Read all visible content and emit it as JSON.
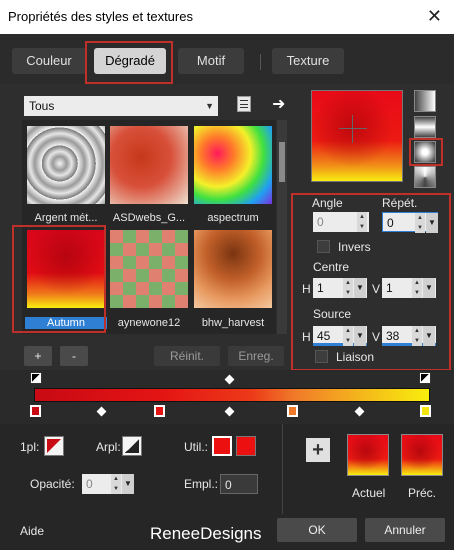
{
  "window": {
    "title": "Propriétés des styles et textures",
    "close": "✕"
  },
  "tabs": [
    {
      "label": "Couleur"
    },
    {
      "label": "Dégradé"
    },
    {
      "label": "Motif"
    },
    {
      "label": "Texture"
    }
  ],
  "category": {
    "value": "Tous"
  },
  "gradients": [
    {
      "label": "Argent mét..."
    },
    {
      "label": "ASDwebs_G..."
    },
    {
      "label": "aspectrum"
    },
    {
      "label": "Autumn"
    },
    {
      "label": "aynewone12"
    },
    {
      "label": "bhw_harvest"
    }
  ],
  "list_buttons": {
    "add": "+",
    "remove": "-",
    "reset": "Réinit.",
    "save": "Enreg."
  },
  "props": {
    "angle_label": "Angle",
    "angle_value": "0",
    "repeat_label": "Répét.",
    "repeat_value": "0",
    "invert_label": "Invers",
    "center_label": "Centre",
    "center_h_label": "H",
    "center_h": "1",
    "center_v_label": "V",
    "center_v": "1",
    "source_label": "Source",
    "source_h_label": "H",
    "source_h": "45",
    "source_v_label": "V",
    "source_v": "38",
    "link_label": "Liaison"
  },
  "bottom": {
    "first_plan_label": "1pl:",
    "background_label": "Arpl:",
    "user_label": "Util.:",
    "opacity_label": "Opacité:",
    "opacity_value": "0",
    "position_label": "Empl.:",
    "position_value": "0",
    "add_icon_label": "+",
    "current_label": "Actuel",
    "previous_label": "Préc."
  },
  "footer": {
    "help": "Aide",
    "watermark": "ReneeDesigns",
    "ok": "OK",
    "cancel": "Annuler"
  },
  "colors": {
    "accent_red": "#c0302a",
    "selection_blue": "#2f7fd4",
    "stop_red": "#e41414",
    "stop_orange": "#f07a2a",
    "stop_yellow": "#f4e60c"
  }
}
